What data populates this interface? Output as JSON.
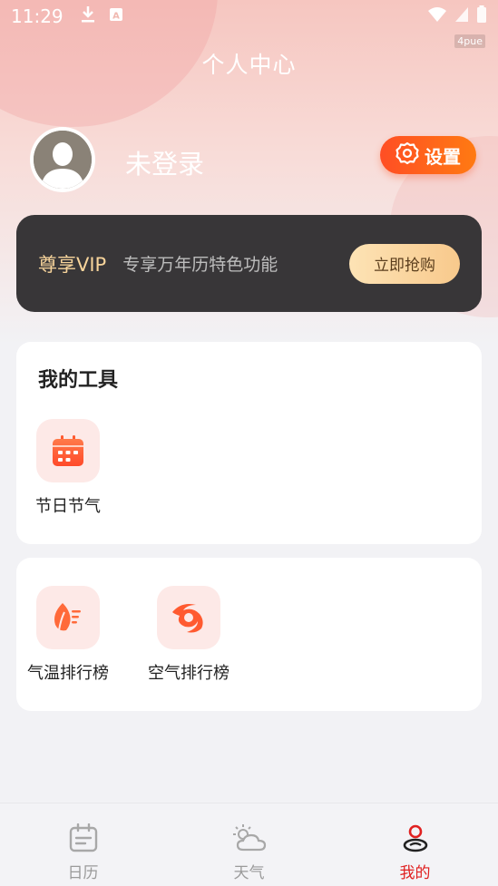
{
  "status_bar": {
    "time": "11:29",
    "carrier": "4pue",
    "icons_left": [
      "download-icon",
      "a-icon"
    ],
    "icons_right": [
      "wifi-icon",
      "signal-icon",
      "battery-icon"
    ]
  },
  "header": {
    "title": "个人中心"
  },
  "profile": {
    "name": "未登录",
    "settings_label": "设置"
  },
  "vip": {
    "title": "尊享VIP",
    "description": "专享万年历特色功能",
    "button_label": "立即抢购"
  },
  "tools": {
    "title": "我的工具",
    "items": [
      {
        "label": "节日节气",
        "icon": "calendar-icon"
      }
    ]
  },
  "rankings": {
    "items": [
      {
        "label": "气温排行榜",
        "icon": "leaf-temperature-icon"
      },
      {
        "label": "空气排行榜",
        "icon": "cyclone-icon"
      }
    ]
  },
  "tabbar": {
    "items": [
      {
        "label": "日历",
        "icon": "calendar-tab-icon",
        "active": false
      },
      {
        "label": "天气",
        "icon": "weather-tab-icon",
        "active": false
      },
      {
        "label": "我的",
        "icon": "profile-tab-icon",
        "active": true
      }
    ]
  },
  "colors": {
    "accent": "#ff5a1e",
    "vip_gold": "#f7d49b",
    "active_tab": "#e02020"
  }
}
